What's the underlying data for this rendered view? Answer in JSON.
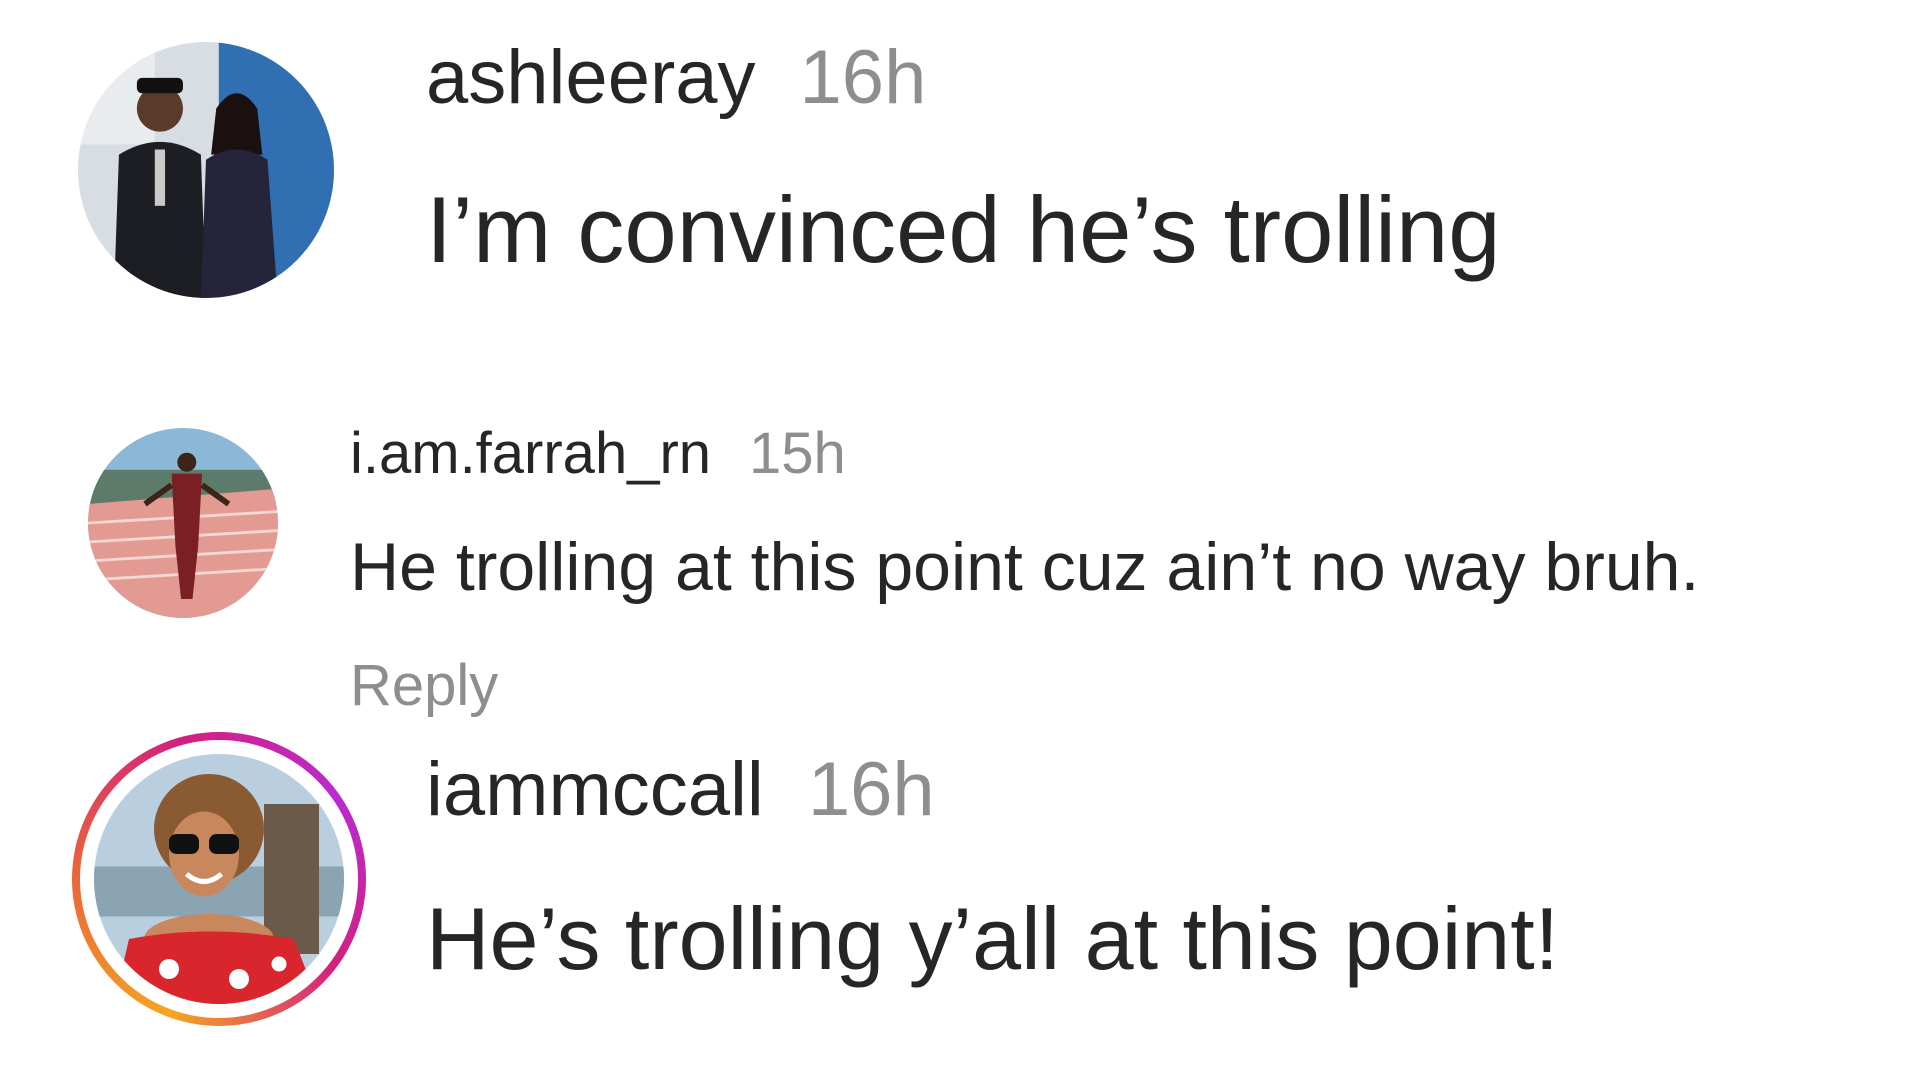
{
  "comments": [
    {
      "username": "ashleeray",
      "time": "16h",
      "text": "I’m convinced he’s trolling",
      "avatar": {
        "icon": "profile-photo-two-people",
        "has_story_ring": false
      }
    },
    {
      "username": "i.am.farrah_rn",
      "time": "15h",
      "text": "He trolling at this point cuz ain’t no way bruh.",
      "reply_label": "Reply",
      "avatar": {
        "icon": "profile-photo-person-on-balcony",
        "has_story_ring": false
      }
    },
    {
      "username": "iammccall",
      "time": "16h",
      "text": "He’s trolling y’all at this point!",
      "avatar": {
        "icon": "profile-photo-woman-sunglasses",
        "has_story_ring": true
      }
    }
  ],
  "colors": {
    "text_primary": "#262626",
    "text_secondary": "#8e8e8e",
    "story_ring_start": "#f6a623",
    "story_ring_end": "#b92bd1",
    "background": "#ffffff"
  }
}
